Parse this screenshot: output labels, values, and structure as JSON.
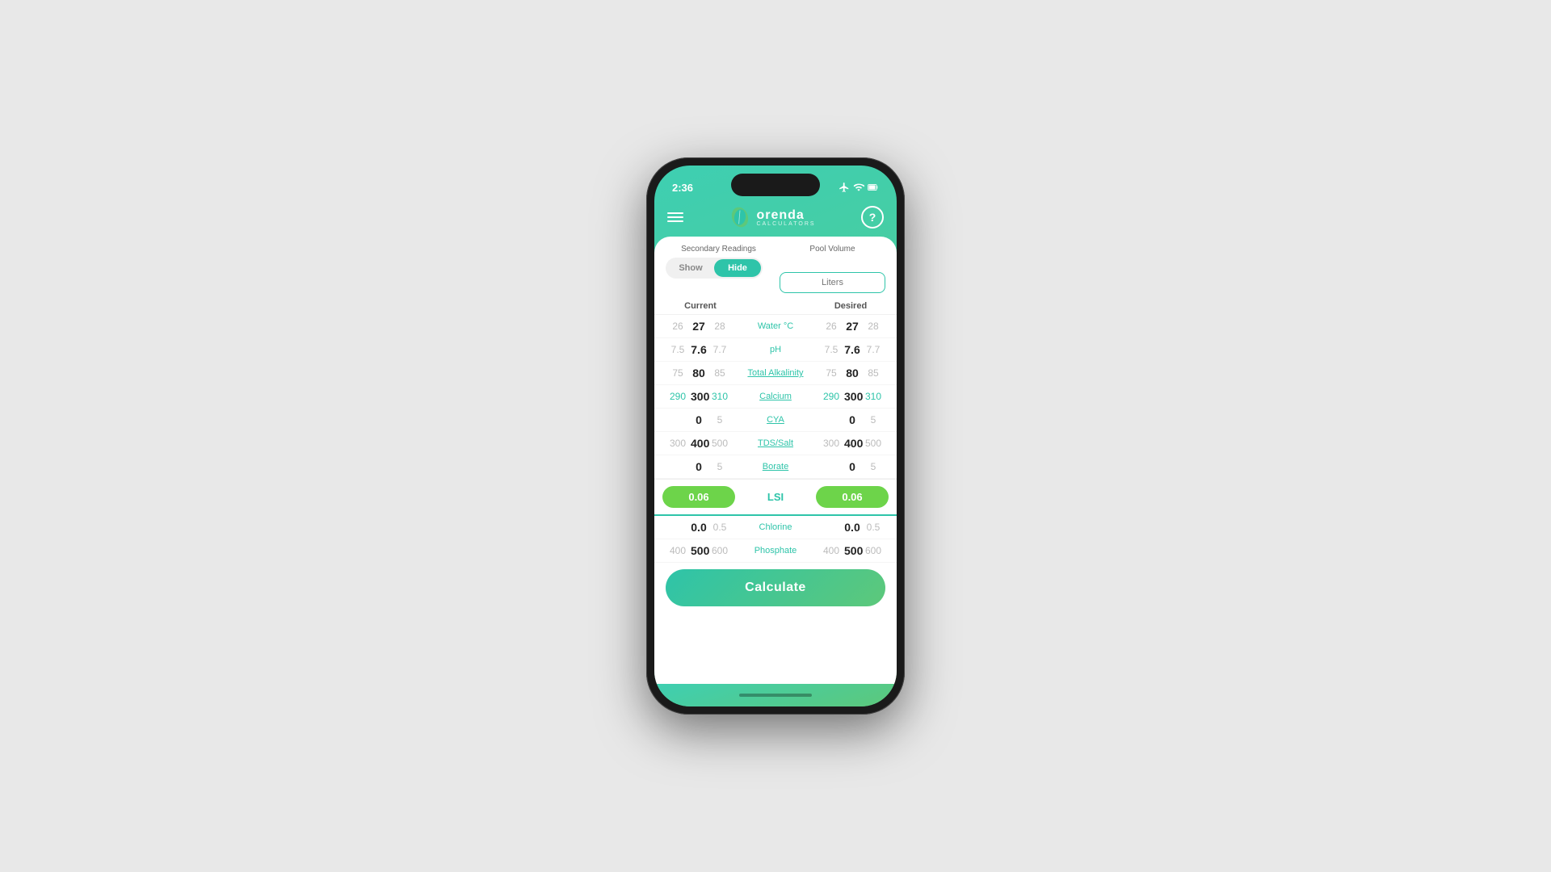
{
  "status": {
    "time": "2:36",
    "icons": [
      "airplane",
      "wifi",
      "battery"
    ]
  },
  "header": {
    "app_name": "orenda",
    "app_sub": "CALCULATORS",
    "help_label": "?"
  },
  "controls": {
    "secondary_readings_label": "Secondary Readings",
    "show_label": "Show",
    "hide_label": "Hide",
    "pool_volume_label": "Pool Volume",
    "pool_volume_placeholder": "Liters"
  },
  "table": {
    "current_header": "Current",
    "desired_header": "Desired",
    "rows": [
      {
        "param": "Water °C",
        "current": {
          "low": "26",
          "mid": "27",
          "high": "28"
        },
        "desired": {
          "low": "26",
          "mid": "27",
          "high": "28"
        },
        "underline": false
      },
      {
        "param": "pH",
        "current": {
          "low": "7.5",
          "mid": "7.6",
          "high": "7.7"
        },
        "desired": {
          "low": "7.5",
          "mid": "7.6",
          "high": "7.7"
        },
        "underline": false
      },
      {
        "param": "Total Alkalinity",
        "current": {
          "low": "75",
          "mid": "80",
          "high": "85"
        },
        "desired": {
          "low": "75",
          "mid": "80",
          "high": "85"
        },
        "underline": false
      },
      {
        "param": "Calcium",
        "current": {
          "low": "290",
          "mid": "300",
          "high": "310"
        },
        "desired": {
          "low": "290",
          "mid": "300",
          "high": "310"
        },
        "underline": false
      },
      {
        "param": "CYA",
        "current": {
          "low": "",
          "mid": "0",
          "high": "5"
        },
        "desired": {
          "low": "",
          "mid": "0",
          "high": "5"
        },
        "underline": true
      },
      {
        "param": "TDS/Salt",
        "current": {
          "low": "300",
          "mid": "400",
          "high": "500"
        },
        "desired": {
          "low": "300",
          "mid": "400",
          "high": "500"
        },
        "underline": true
      },
      {
        "param": "Borate",
        "current": {
          "low": "",
          "mid": "0",
          "high": "5"
        },
        "desired": {
          "low": "",
          "mid": "0",
          "high": "5"
        },
        "underline": true
      }
    ],
    "lsi": {
      "param": "LSI",
      "current_value": "0.06",
      "desired_value": "0.06"
    },
    "secondary_rows": [
      {
        "param": "Chlorine",
        "current": {
          "low": "",
          "mid": "0.0",
          "high": "0.5"
        },
        "desired": {
          "low": "",
          "mid": "0.0",
          "high": "0.5"
        },
        "underline": false
      },
      {
        "param": "Phosphate",
        "current": {
          "low": "400",
          "mid": "500",
          "high": "600"
        },
        "desired": {
          "low": "400",
          "mid": "500",
          "high": "600"
        },
        "underline": false
      }
    ]
  },
  "calculate_button_label": "Calculate"
}
